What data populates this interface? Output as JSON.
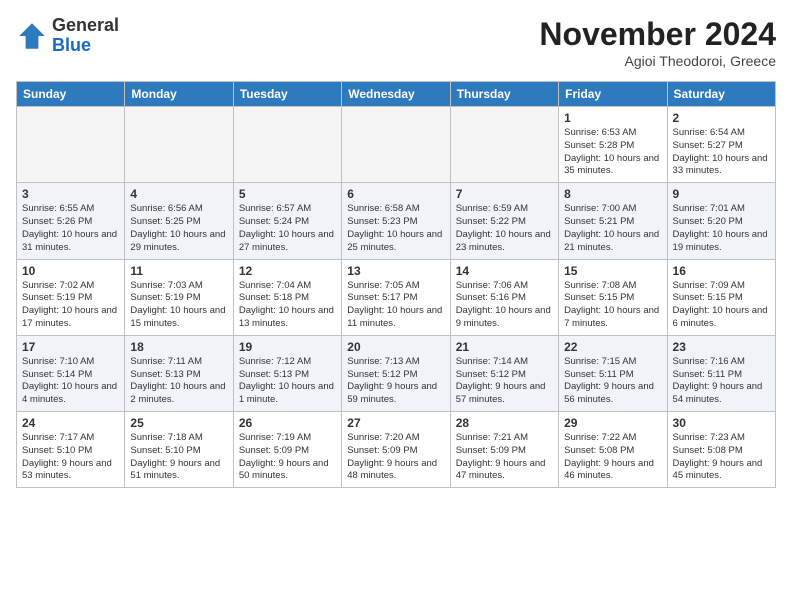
{
  "header": {
    "logo_general": "General",
    "logo_blue": "Blue",
    "month_year": "November 2024",
    "location": "Agioi Theodoroi, Greece"
  },
  "days_of_week": [
    "Sunday",
    "Monday",
    "Tuesday",
    "Wednesday",
    "Thursday",
    "Friday",
    "Saturday"
  ],
  "weeks": [
    {
      "id": "week1",
      "days": [
        {
          "date": "",
          "info": ""
        },
        {
          "date": "",
          "info": ""
        },
        {
          "date": "",
          "info": ""
        },
        {
          "date": "",
          "info": ""
        },
        {
          "date": "",
          "info": ""
        },
        {
          "date": "1",
          "info": "Sunrise: 6:53 AM\nSunset: 5:28 PM\nDaylight: 10 hours and 35 minutes."
        },
        {
          "date": "2",
          "info": "Sunrise: 6:54 AM\nSunset: 5:27 PM\nDaylight: 10 hours and 33 minutes."
        }
      ]
    },
    {
      "id": "week2",
      "days": [
        {
          "date": "3",
          "info": "Sunrise: 6:55 AM\nSunset: 5:26 PM\nDaylight: 10 hours and 31 minutes."
        },
        {
          "date": "4",
          "info": "Sunrise: 6:56 AM\nSunset: 5:25 PM\nDaylight: 10 hours and 29 minutes."
        },
        {
          "date": "5",
          "info": "Sunrise: 6:57 AM\nSunset: 5:24 PM\nDaylight: 10 hours and 27 minutes."
        },
        {
          "date": "6",
          "info": "Sunrise: 6:58 AM\nSunset: 5:23 PM\nDaylight: 10 hours and 25 minutes."
        },
        {
          "date": "7",
          "info": "Sunrise: 6:59 AM\nSunset: 5:22 PM\nDaylight: 10 hours and 23 minutes."
        },
        {
          "date": "8",
          "info": "Sunrise: 7:00 AM\nSunset: 5:21 PM\nDaylight: 10 hours and 21 minutes."
        },
        {
          "date": "9",
          "info": "Sunrise: 7:01 AM\nSunset: 5:20 PM\nDaylight: 10 hours and 19 minutes."
        }
      ]
    },
    {
      "id": "week3",
      "days": [
        {
          "date": "10",
          "info": "Sunrise: 7:02 AM\nSunset: 5:19 PM\nDaylight: 10 hours and 17 minutes."
        },
        {
          "date": "11",
          "info": "Sunrise: 7:03 AM\nSunset: 5:19 PM\nDaylight: 10 hours and 15 minutes."
        },
        {
          "date": "12",
          "info": "Sunrise: 7:04 AM\nSunset: 5:18 PM\nDaylight: 10 hours and 13 minutes."
        },
        {
          "date": "13",
          "info": "Sunrise: 7:05 AM\nSunset: 5:17 PM\nDaylight: 10 hours and 11 minutes."
        },
        {
          "date": "14",
          "info": "Sunrise: 7:06 AM\nSunset: 5:16 PM\nDaylight: 10 hours and 9 minutes."
        },
        {
          "date": "15",
          "info": "Sunrise: 7:08 AM\nSunset: 5:15 PM\nDaylight: 10 hours and 7 minutes."
        },
        {
          "date": "16",
          "info": "Sunrise: 7:09 AM\nSunset: 5:15 PM\nDaylight: 10 hours and 6 minutes."
        }
      ]
    },
    {
      "id": "week4",
      "days": [
        {
          "date": "17",
          "info": "Sunrise: 7:10 AM\nSunset: 5:14 PM\nDaylight: 10 hours and 4 minutes."
        },
        {
          "date": "18",
          "info": "Sunrise: 7:11 AM\nSunset: 5:13 PM\nDaylight: 10 hours and 2 minutes."
        },
        {
          "date": "19",
          "info": "Sunrise: 7:12 AM\nSunset: 5:13 PM\nDaylight: 10 hours and 1 minute."
        },
        {
          "date": "20",
          "info": "Sunrise: 7:13 AM\nSunset: 5:12 PM\nDaylight: 9 hours and 59 minutes."
        },
        {
          "date": "21",
          "info": "Sunrise: 7:14 AM\nSunset: 5:12 PM\nDaylight: 9 hours and 57 minutes."
        },
        {
          "date": "22",
          "info": "Sunrise: 7:15 AM\nSunset: 5:11 PM\nDaylight: 9 hours and 56 minutes."
        },
        {
          "date": "23",
          "info": "Sunrise: 7:16 AM\nSunset: 5:11 PM\nDaylight: 9 hours and 54 minutes."
        }
      ]
    },
    {
      "id": "week5",
      "days": [
        {
          "date": "24",
          "info": "Sunrise: 7:17 AM\nSunset: 5:10 PM\nDaylight: 9 hours and 53 minutes."
        },
        {
          "date": "25",
          "info": "Sunrise: 7:18 AM\nSunset: 5:10 PM\nDaylight: 9 hours and 51 minutes."
        },
        {
          "date": "26",
          "info": "Sunrise: 7:19 AM\nSunset: 5:09 PM\nDaylight: 9 hours and 50 minutes."
        },
        {
          "date": "27",
          "info": "Sunrise: 7:20 AM\nSunset: 5:09 PM\nDaylight: 9 hours and 48 minutes."
        },
        {
          "date": "28",
          "info": "Sunrise: 7:21 AM\nSunset: 5:09 PM\nDaylight: 9 hours and 47 minutes."
        },
        {
          "date": "29",
          "info": "Sunrise: 7:22 AM\nSunset: 5:08 PM\nDaylight: 9 hours and 46 minutes."
        },
        {
          "date": "30",
          "info": "Sunrise: 7:23 AM\nSunset: 5:08 PM\nDaylight: 9 hours and 45 minutes."
        }
      ]
    }
  ]
}
